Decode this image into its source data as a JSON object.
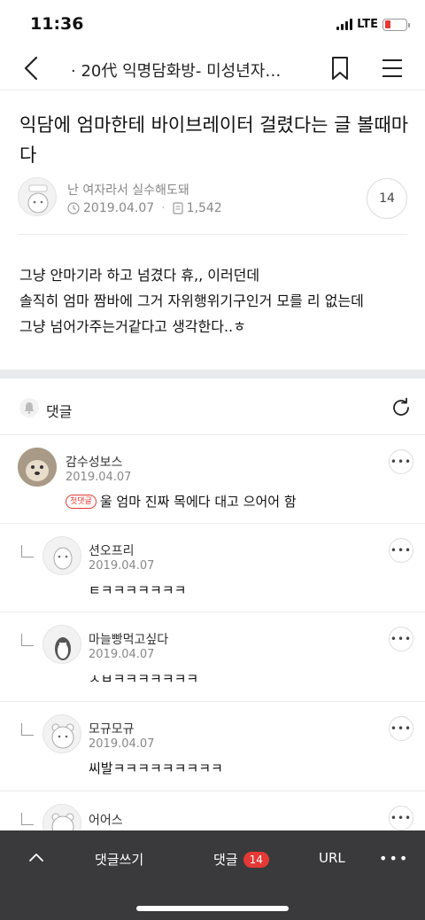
{
  "status": {
    "time": "11:36",
    "network": "LTE"
  },
  "nav": {
    "title": "· 20代 익명담화방- 미성년자…"
  },
  "post": {
    "title": "익담에 엄마한테 바이브레이터 걸렸다는 글 볼때마다",
    "author": "난 여자라서 실수해도돼",
    "date": "2019.04.07",
    "views": "1,542",
    "comment_count": "14",
    "body": [
      "그냥 안마기라 하고 넘겼다 휴,, 이러던데",
      "솔직히 엄마 짬바에 그거 자위행위기구인거 모를 리 없는데",
      "그냥 넘어가주는거같다고 생각한다..ㅎ"
    ]
  },
  "comments_section": {
    "label": "댓글"
  },
  "comments": [
    {
      "name": "감수성보스",
      "date": "2019.04.07",
      "badge": "첫댓글",
      "text": "울 엄마 진짜 목에다 대고 으어어 함"
    },
    {
      "name": "션오프리",
      "date": "2019.04.07",
      "text": "ㅌㅋㅋㅋㅋㅋㅋㅋ"
    },
    {
      "name": "마늘빵먹고싶다",
      "date": "2019.04.07",
      "text": "ㅅㅂㅋㅋㅋㅋㅋㅋㅋ"
    },
    {
      "name": "모규모규",
      "date": "2019.04.07",
      "text": "씨발ㅋㅋㅋㅋㅋㅋㅋㅋㅋ"
    },
    {
      "name": "어어스"
    }
  ],
  "bottom_bar": {
    "write_label": "댓글쓰기",
    "comments_label": "댓글",
    "comments_count": "14",
    "url_label": "URL",
    "more_label": "•••"
  },
  "colors": {
    "accent": "#e53935",
    "bottom_bar": "#3a3a3c",
    "section_gap": "#e8eaed"
  },
  "icons": [
    "back-icon",
    "bookmark-icon",
    "menu-icon",
    "clock-icon",
    "document-icon",
    "bell-icon",
    "refresh-icon",
    "chevron-up-icon"
  ]
}
